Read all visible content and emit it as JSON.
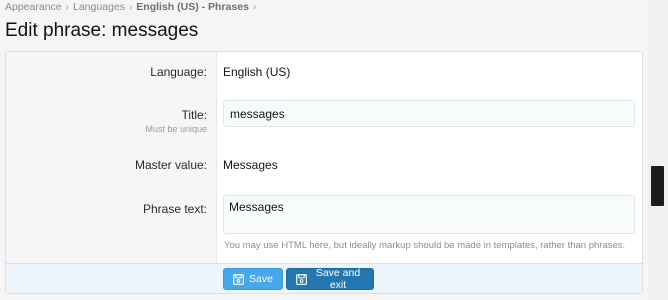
{
  "breadcrumb": {
    "items": [
      "Appearance",
      "Languages",
      "English (US) - Phrases"
    ],
    "separator": "›"
  },
  "page": {
    "title": "Edit phrase: messages"
  },
  "form": {
    "language": {
      "label": "Language:",
      "value": "English (US)"
    },
    "title": {
      "label": "Title:",
      "hint": "Must be unique",
      "value": "messages"
    },
    "master": {
      "label": "Master value:",
      "value": "Messages"
    },
    "phrase": {
      "label": "Phrase text:",
      "value": "Messages",
      "explain": "You may use HTML here, but ideally markup should be made in templates, rather than phrases."
    }
  },
  "buttons": {
    "save": "Save",
    "save_exit": "Save and exit"
  },
  "colors": {
    "accent": "#47a7eb",
    "accent_dark": "#2577b1",
    "submit_bg": "#edf4fb"
  },
  "icons": {
    "save": "floppy-disk-icon",
    "separator": "chevron-right-icon"
  }
}
